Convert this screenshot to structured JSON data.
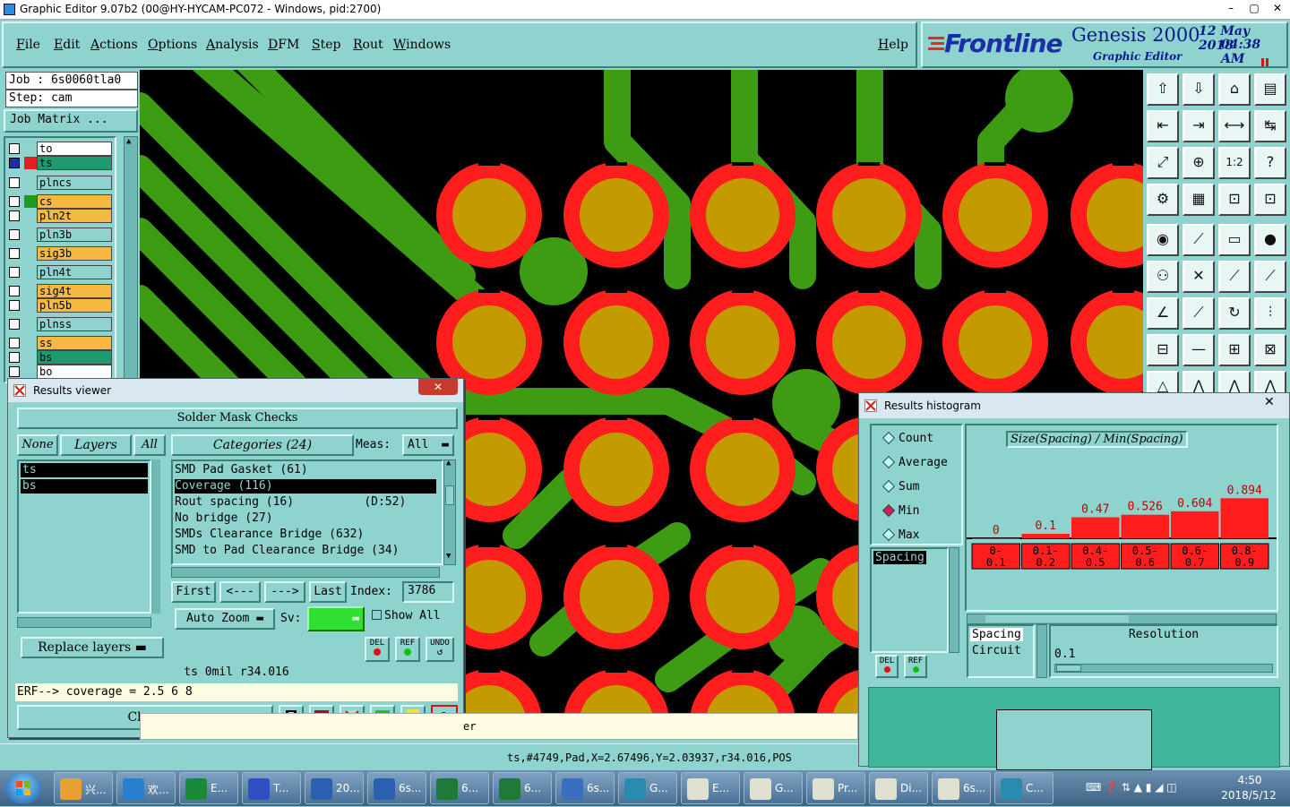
{
  "window": {
    "title": "Graphic Editor 9.07b2 (00@HY-HYCAM-PC072 - Windows, pid:2700)",
    "controls": [
      "–",
      "▢",
      "✕"
    ]
  },
  "menu": [
    "File",
    "Edit",
    "Actions",
    "Options",
    "Analysis",
    "DFM",
    "Step",
    "Rout",
    "Windows"
  ],
  "help_label": "Help",
  "logo": {
    "brand": "Frontline",
    "product": "Genesis 2000",
    "subtitle": "Graphic Editor",
    "date": "12 May 2018",
    "time": "04:38 AM"
  },
  "job": {
    "job_line": "Job : 6s0060tla0",
    "step_line": "Step: cam",
    "matrix_button": "Job Matrix ..."
  },
  "layers": [
    {
      "name": "to",
      "color": "#ffffff",
      "swatch": ""
    },
    {
      "name": "ts",
      "color": "#1f9a6e",
      "swatch": "#e02020"
    },
    {
      "name": "plncs",
      "color": "#8fd3cf",
      "swatch": ""
    },
    {
      "name": "cs",
      "color": "#f5b942",
      "swatch": "#1f9a1f"
    },
    {
      "name": "pln2t",
      "color": "#f5b942",
      "swatch": ""
    },
    {
      "name": "pln3b",
      "color": "#8fd3cf",
      "swatch": ""
    },
    {
      "name": "sig3b",
      "color": "#f5b942",
      "swatch": ""
    },
    {
      "name": "pln4t",
      "color": "#8fd3cf",
      "swatch": ""
    },
    {
      "name": "sig4t",
      "color": "#f5b942",
      "swatch": ""
    },
    {
      "name": "pln5b",
      "color": "#f5b942",
      "swatch": ""
    },
    {
      "name": "plnss",
      "color": "#8fd3cf",
      "swatch": ""
    },
    {
      "name": "ss",
      "color": "#f5b942",
      "swatch": ""
    },
    {
      "name": "bs",
      "color": "#1f9a6e",
      "swatch": ""
    },
    {
      "name": "bo",
      "color": "#ffffff",
      "swatch": ""
    }
  ],
  "results_viewer": {
    "title": "Results viewer",
    "heading": "Solder Mask Checks",
    "none_btn": "None",
    "layers_btn": "Layers",
    "all_btn": "All",
    "layer_list": [
      "ts",
      "bs"
    ],
    "categories_btn": "Categories (24)",
    "meas_label": "Meas:",
    "meas_value": "All",
    "categories": [
      {
        "text": "SMD Pad Gasket (61)",
        "selected": false
      },
      {
        "text": "Coverage (116)",
        "selected": true
      },
      {
        "text": "Rout spacing (16)          (D:52)",
        "selected": false
      },
      {
        "text": "No bridge (27)",
        "selected": false
      },
      {
        "text": "SMDs Clearance Bridge (632)",
        "selected": false
      },
      {
        "text": "SMD to Pad Clearance Bridge (34)",
        "selected": false
      }
    ],
    "nav": {
      "first": "First",
      "prev": "<---",
      "next": "--->",
      "last": "Last",
      "index_label": "Index:",
      "index_value": "3786"
    },
    "zoom_label": "Auto Zoom",
    "sv_label": "Sv:",
    "show_all_label": "Show All",
    "replace_label": "Replace layers",
    "del_label": "DEL",
    "ref_label": "REF",
    "undo_label": "UNDO",
    "info_line": "ts 0mil  r34.016",
    "erf_line": "ERF--> coverage = 2.5 6 8",
    "close_label": "Close"
  },
  "histogram": {
    "title": "Results histogram",
    "modes": [
      {
        "label": "Count",
        "selected": false
      },
      {
        "label": "Average",
        "selected": false
      },
      {
        "label": "Sum",
        "selected": false
      },
      {
        "label": "Min",
        "selected": true
      },
      {
        "label": "Max",
        "selected": false
      }
    ],
    "chart_title": "Size(Spacing) / Min(Spacing)",
    "list_items": [
      "Spacing"
    ],
    "list2_items": [
      "Spacing",
      "Circuit"
    ],
    "resolution_label": "Resolution",
    "resolution_value": "0.1",
    "del_label": "DEL",
    "ref_label": "REF",
    "accent": "#ff1e1e"
  },
  "chart_data": {
    "type": "bar",
    "title": "Size(Spacing) / Min(Spacing)",
    "categories": [
      "0-0.1",
      "0.1-0.2",
      "0.4-0.5",
      "0.5-0.6",
      "0.6-0.7",
      "0.8-0.9"
    ],
    "values": [
      0,
      0.1,
      0.47,
      0.526,
      0.604,
      0.894
    ],
    "value_labels": [
      "0",
      "0.1",
      "0.47",
      "0.526",
      "0.604",
      "0.894"
    ],
    "bin_labels": [
      [
        "0-",
        "0.1"
      ],
      [
        "0.1-",
        "0.2"
      ],
      [
        "0.4-",
        "0.5"
      ],
      [
        "0.5-",
        "0.6"
      ],
      [
        "0.6-",
        "0.7"
      ],
      [
        "0.8-",
        "0.9"
      ]
    ],
    "ylim": [
      0,
      1
    ]
  },
  "status": {
    "cursor_info": "ts,#4749,Pad,X=2.67496,Y=2.03937,r34.016,POS",
    "message_fragment": "er"
  },
  "taskbar": {
    "items": [
      {
        "label": "兴...",
        "color": "#e8a030"
      },
      {
        "label": "欢...",
        "color": "#2a7fd0"
      },
      {
        "label": "E...",
        "color": "#1a8a3a"
      },
      {
        "label": "T...",
        "color": "#3050c0"
      },
      {
        "label": "20...",
        "color": "#2b5fb0"
      },
      {
        "label": "6s...",
        "color": "#2b5fb0"
      },
      {
        "label": "6...",
        "color": "#1f7a3a"
      },
      {
        "label": "6...",
        "color": "#1f7a3a"
      },
      {
        "label": "6s...",
        "color": "#3a6ec0"
      },
      {
        "label": "G...",
        "color": "#2a8ab0"
      },
      {
        "label": "E...",
        "color": "#e0e0d0"
      },
      {
        "label": "G...",
        "color": "#e0e0d0"
      },
      {
        "label": "Pr...",
        "color": "#e0e0d0"
      },
      {
        "label": "Di...",
        "color": "#e0e0d0"
      },
      {
        "label": "6s...",
        "color": "#e0e0d0"
      },
      {
        "label": "C...",
        "color": "#2a8ab0"
      }
    ],
    "clock_time": "4:50",
    "clock_date": "2018/5/12"
  },
  "colors": {
    "panel": "#8fd3cf",
    "trace": "#3e9b14",
    "pad_ring": "#ff1e1e",
    "pad_core": "#c39b00"
  }
}
